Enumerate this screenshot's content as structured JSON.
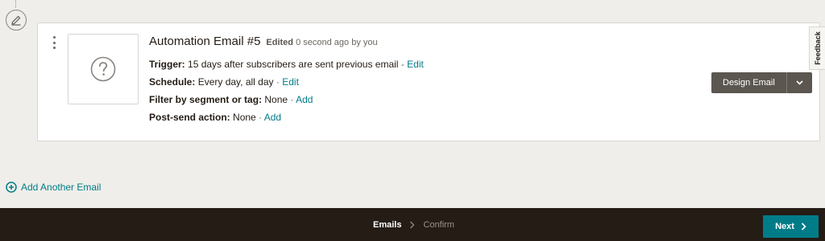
{
  "email_card": {
    "title": "Automation Email #5",
    "edited_label": "Edited",
    "edited_time": "0 second ago by you",
    "trigger": {
      "label": "Trigger:",
      "value": "15 days after subscribers are sent previous email",
      "sep": "-",
      "action": "Edit"
    },
    "schedule": {
      "label": "Schedule:",
      "value": "Every day, all day",
      "sep": "·",
      "action": "Edit"
    },
    "filter": {
      "label": "Filter by segment or tag:",
      "value": "None",
      "sep": "·",
      "action": "Add"
    },
    "post_send": {
      "label": "Post-send action:",
      "value": "None",
      "sep": "·",
      "action": "Add"
    },
    "design_button": "Design Email"
  },
  "feedback_tab": "Feedback",
  "add_email_label": "Add Another Email",
  "footer": {
    "steps": [
      "Emails",
      "Confirm"
    ],
    "active_step": "Emails",
    "next_label": "Next"
  },
  "icons": {
    "edit": "pencil-icon",
    "placeholder": "question-mark-icon",
    "add": "plus-circle-icon",
    "caret": "chevron-down-icon",
    "next": "chevron-right-icon",
    "menu": "kebab-menu-icon"
  },
  "colors": {
    "accent": "#007c89",
    "footer_bg": "#241c15",
    "design_button_bg": "#5b5650",
    "page_bg": "#efeeea"
  }
}
